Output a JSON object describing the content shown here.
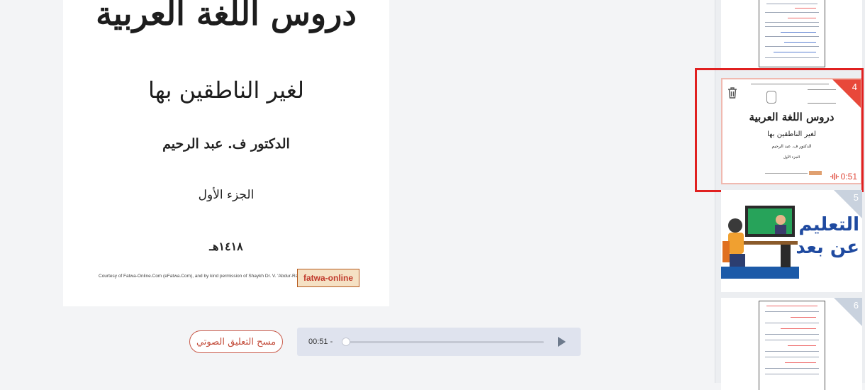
{
  "document": {
    "title": "دروس اللغة العربية",
    "subtitle": "لغير الناطقين بها",
    "author": "الدكتور ف. عبد الرحيم",
    "part": "الجزء الأول",
    "year": "١٤١٨هـ",
    "credit": "Courtesy of Fatwa-Online.Com (eFatwa.Com), and by kind permission of Shaykh Dr. V. 'Abdur-Raheem",
    "logo_text": "fatwa-online"
  },
  "audio": {
    "clear_label": "مسح التعليق الصوتي",
    "time": "00:51 -",
    "progress": 0
  },
  "slides": [
    {
      "number": "4",
      "selected": true,
      "audio_duration": "0:51",
      "mini_title": "دروس اللغة العربية",
      "mini_subtitle": "لغير الناطقين بها",
      "mini_author": "الدكتور ف. عبد الرحيم",
      "mini_part": "الجزء الأول"
    },
    {
      "number": "5",
      "banner_line1": "التعليم",
      "banner_line2": "عن بعد"
    },
    {
      "number": "6"
    }
  ],
  "colors": {
    "accent_red": "#e02020",
    "player_bg": "#dfe3ee"
  }
}
